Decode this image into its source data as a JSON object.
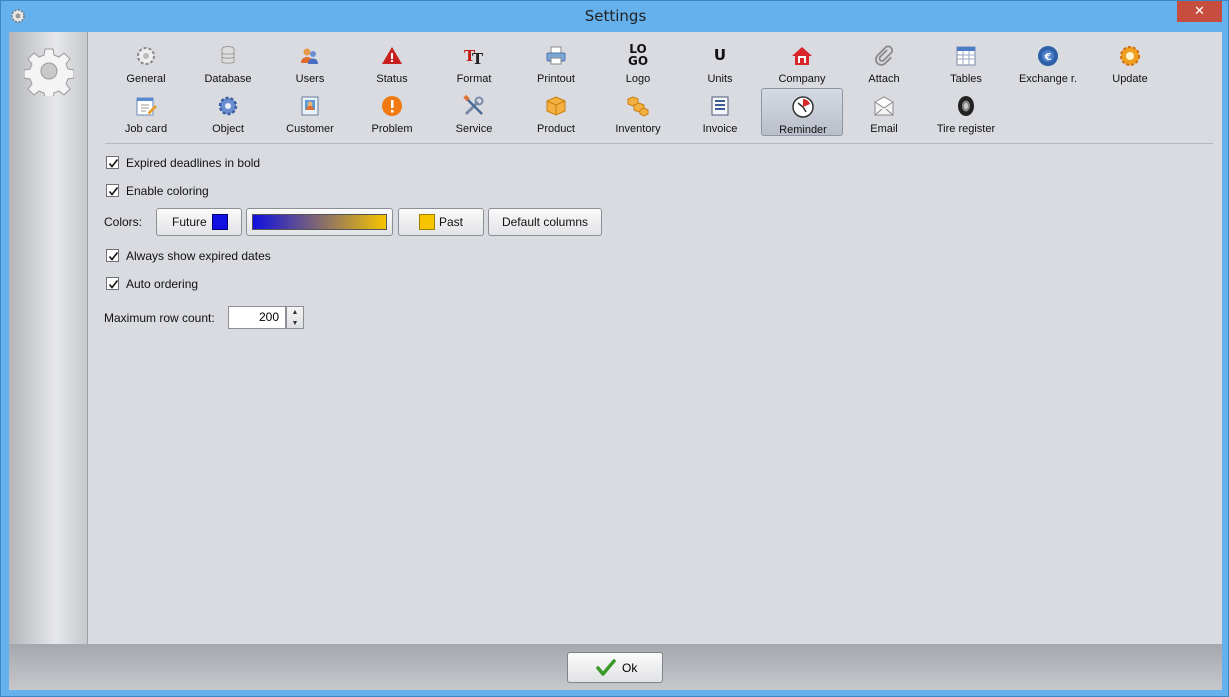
{
  "window": {
    "title": "Settings",
    "close_symbol": "✕"
  },
  "toolbar": {
    "row1": [
      {
        "label": "General",
        "icon": "gear-icon"
      },
      {
        "label": "Database",
        "icon": "database-icon"
      },
      {
        "label": "Users",
        "icon": "users-icon"
      },
      {
        "label": "Status",
        "icon": "warning-icon"
      },
      {
        "label": "Format",
        "icon": "font-format-icon"
      },
      {
        "label": "Printout",
        "icon": "printer-icon"
      },
      {
        "label": "Logo",
        "icon": "logo-icon"
      },
      {
        "label": "Units",
        "icon": "units-icon"
      },
      {
        "label": "Company",
        "icon": "house-icon"
      },
      {
        "label": "Attach",
        "icon": "paperclip-icon"
      },
      {
        "label": "Tables",
        "icon": "table-icon"
      },
      {
        "label": "Exchange r.",
        "icon": "currency-exchange-icon"
      },
      {
        "label": "Update",
        "icon": "update-icon"
      }
    ],
    "row2": [
      {
        "label": "Job card",
        "icon": "job-card-icon"
      },
      {
        "label": "Object",
        "icon": "cog-icon"
      },
      {
        "label": "Customer",
        "icon": "customer-card-icon"
      },
      {
        "label": "Problem",
        "icon": "exclamation-icon"
      },
      {
        "label": "Service",
        "icon": "tools-icon"
      },
      {
        "label": "Product",
        "icon": "box-icon"
      },
      {
        "label": "Inventory",
        "icon": "boxes-icon"
      },
      {
        "label": "Invoice",
        "icon": "invoice-icon"
      },
      {
        "label": "Reminder",
        "icon": "clock-icon"
      },
      {
        "label": "Email",
        "icon": "envelope-icon"
      },
      {
        "label": "Tire register",
        "icon": "tire-icon"
      }
    ],
    "selected": "Reminder",
    "logo_text_top": "LO",
    "logo_text_bottom": "GO",
    "units_glyph": "U"
  },
  "options": {
    "expired_bold": {
      "label": "Expired deadlines in bold",
      "checked": true
    },
    "enable_coloring": {
      "label": "Enable coloring",
      "checked": true
    },
    "always_show_expired": {
      "label": "Always show expired dates",
      "checked": true
    },
    "auto_ordering": {
      "label": "Auto ordering",
      "checked": true
    }
  },
  "colors": {
    "label": "Colors:",
    "future_label": "Future",
    "future_color": "#1010e0",
    "past_label": "Past",
    "past_color": "#f6c400",
    "default_columns_label": "Default columns"
  },
  "max_rows": {
    "label": "Maximum row count:",
    "value": "200"
  },
  "footer": {
    "ok_label": "Ok"
  }
}
